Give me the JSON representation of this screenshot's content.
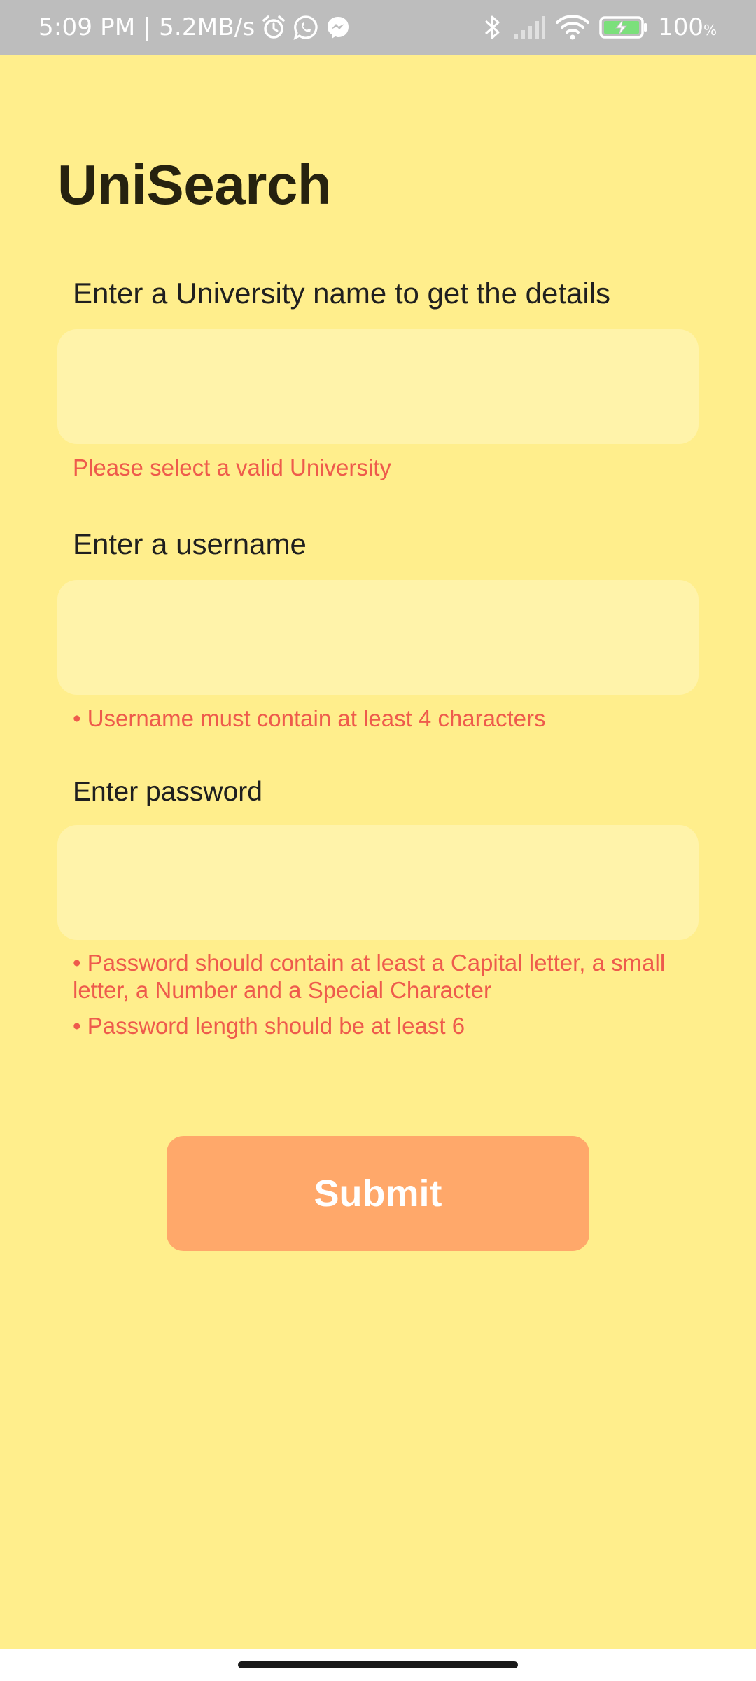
{
  "status_bar": {
    "time": "5:09 PM | 5.2MB/s",
    "battery_percent": "100",
    "battery_unit": "%",
    "icons_left": [
      "alarm-icon",
      "whatsapp-icon",
      "messenger-icon"
    ],
    "icons_right": [
      "bluetooth-icon",
      "signal-icon",
      "wifi-icon",
      "battery-icon"
    ],
    "battery_level": 1.0
  },
  "app": {
    "title": "UniSearch"
  },
  "form": {
    "university": {
      "label": "Enter a University name to get the details",
      "value": "",
      "error": "Please select a valid University"
    },
    "username": {
      "label": "Enter a username",
      "value": "",
      "error": "• Username must contain at least 4 characters"
    },
    "password": {
      "label": "Enter password",
      "value": "",
      "errors": [
        "• Password should contain at least a Capital letter, a small letter, a Number and a Special Character",
        "• Password length should be at least 6"
      ]
    },
    "submit_label": "Submit"
  },
  "colors": {
    "background": "#FFEE8C",
    "input_fill": "#FFF3AA",
    "error": "#EE5B4C",
    "submit": "#FFA86A",
    "status_bar": "#BDBDBD"
  }
}
